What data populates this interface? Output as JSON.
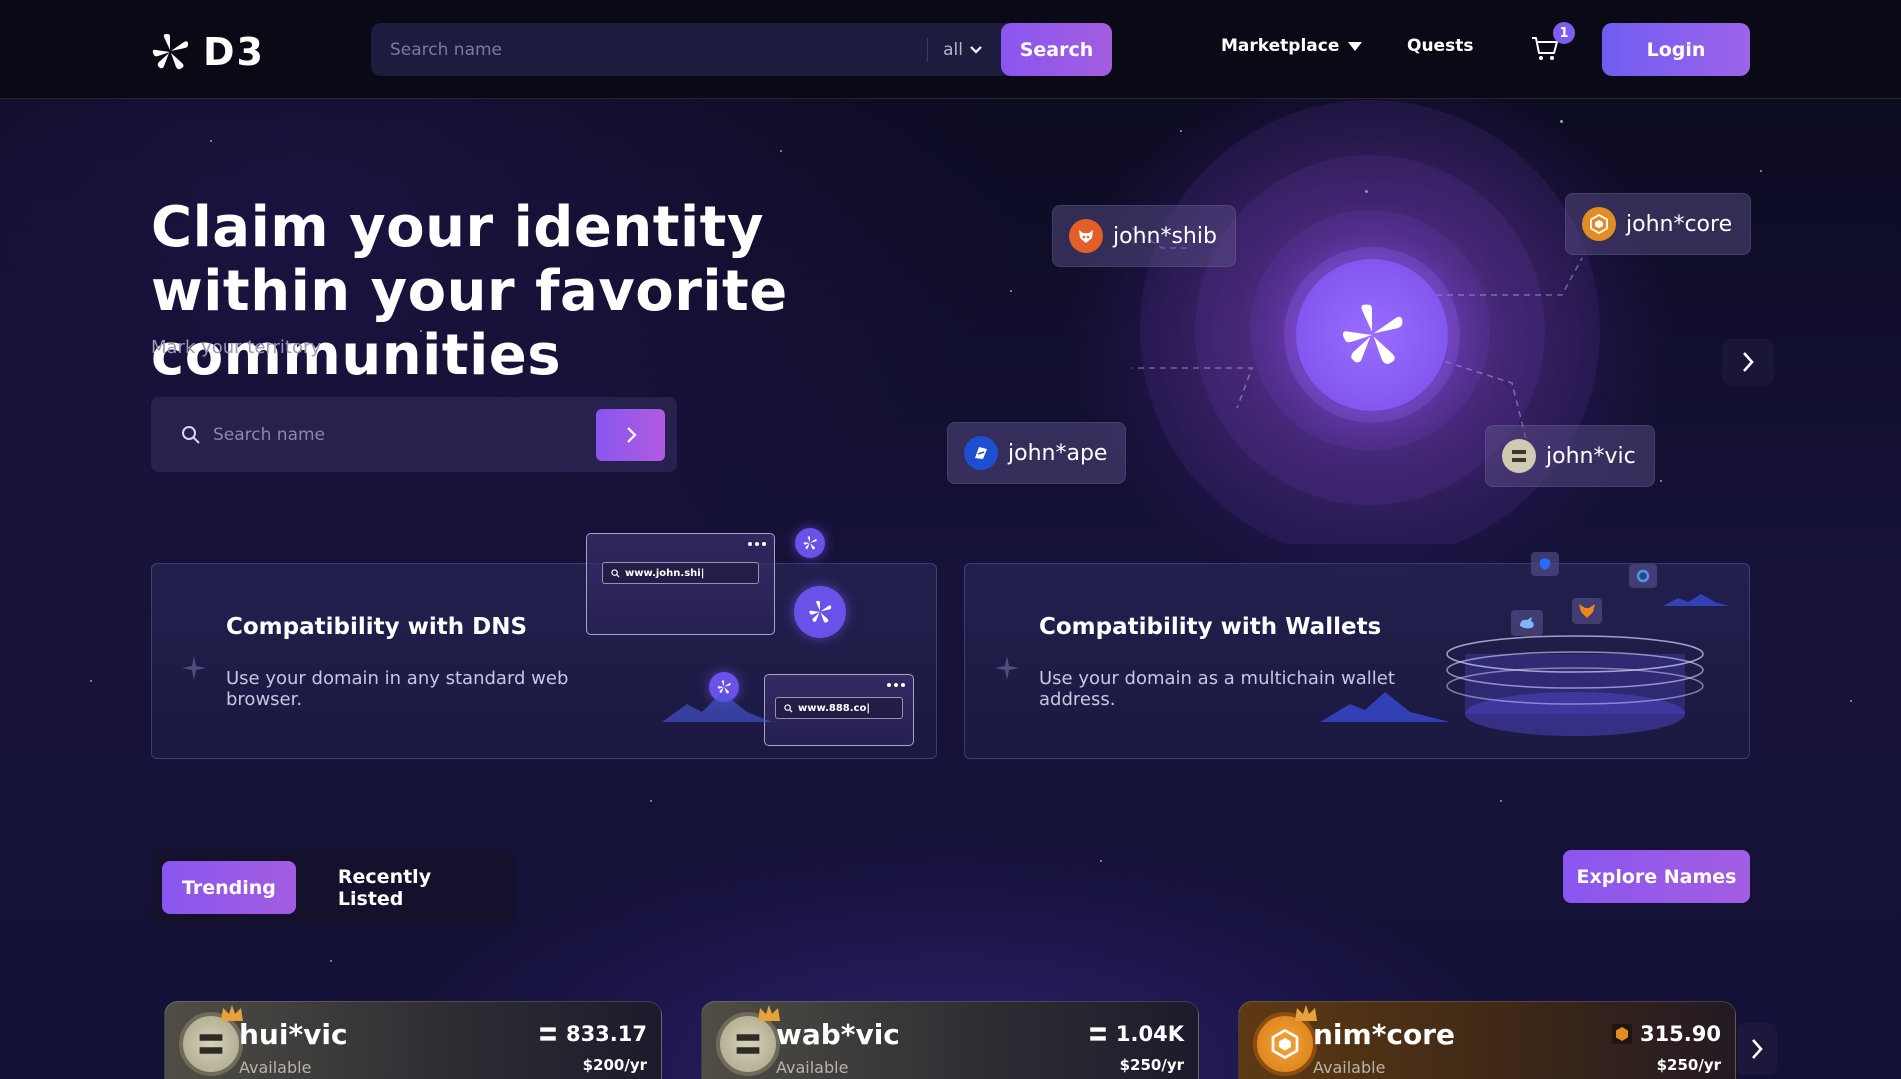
{
  "app": {
    "logo_text": "D3"
  },
  "header": {
    "search_placeholder": "Search name",
    "filter_value": "all",
    "search_button": "Search",
    "nav_marketplace": "Marketplace",
    "nav_quests": "Quests",
    "cart_count": "1",
    "login_button": "Login"
  },
  "hero": {
    "title": "Claim your identity within your favorite communities",
    "subtitle": "Mark your territory",
    "search_placeholder": "Search name"
  },
  "communities": [
    {
      "name": "john*shib",
      "icon": "shib-token-icon"
    },
    {
      "name": "john*core",
      "icon": "core-token-icon"
    },
    {
      "name": "john*ape",
      "icon": "ape-token-icon"
    },
    {
      "name": "john*vic",
      "icon": "vic-token-icon"
    }
  ],
  "features": [
    {
      "title": "Compatibility with DNS",
      "desc": "Use your domain in any standard web browser.",
      "url1": "www.john.shi|",
      "url2": "www.888.co|"
    },
    {
      "title": "Compatibility with Wallets",
      "desc": "Use your domain as a multichain wallet address."
    }
  ],
  "tabs": {
    "trending": "Trending",
    "recently_listed": "Recently Listed"
  },
  "explore_button": "Explore Names",
  "names": [
    {
      "name": "hui*vic",
      "status": "Available",
      "price": "833.17",
      "per_year": "$200/yr",
      "theme": "vic"
    },
    {
      "name": "wab*vic",
      "status": "Available",
      "price": "1.04K",
      "per_year": "$250/yr",
      "theme": "vic"
    },
    {
      "name": "nim*core",
      "status": "Available",
      "price": "315.90",
      "per_year": "$250/yr",
      "theme": "core"
    }
  ],
  "colors": {
    "accent": "#8a56f0",
    "background": "#0b0a1f",
    "header": "#0a0a17"
  }
}
